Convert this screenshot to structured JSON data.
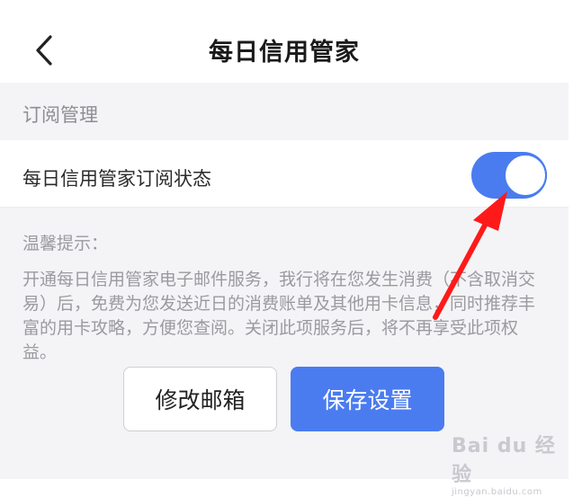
{
  "header": {
    "title": "每日信用管家",
    "back_icon": "chevron-left-icon"
  },
  "section": {
    "label": "订阅管理"
  },
  "subscription_row": {
    "label": "每日信用管家订阅状态",
    "toggle_state": "on"
  },
  "tips": {
    "title": "温馨提示：",
    "body": "开通每日信用管家电子邮件服务，我行将在您发生消费（不含取消交易）后，免费为您发送近日的消费账单及其他用卡信息，同时推荐丰富的用卡攻略，方便您查阅。关闭此项服务后，将不再享受此项权益。"
  },
  "buttons": {
    "edit_email": "修改邮箱",
    "save_settings": "保存设置"
  },
  "watermark": {
    "main": "Bai du 经验",
    "sub": "jingyan.baidu.com"
  },
  "colors": {
    "accent": "#4a7cf0",
    "annotation_arrow": "#ff1a1a",
    "section_bg": "#f4f4f6"
  }
}
